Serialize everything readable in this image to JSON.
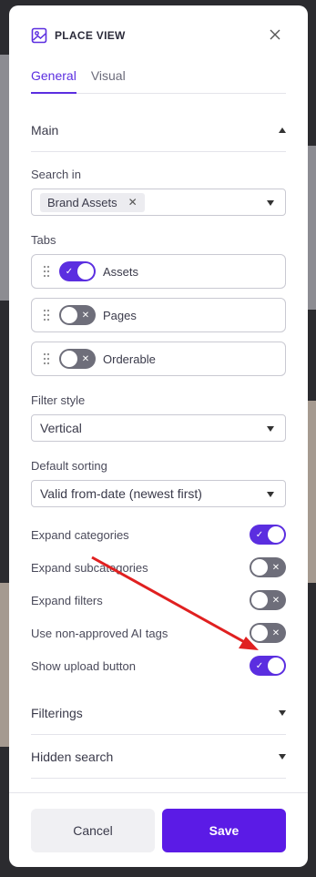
{
  "dialog": {
    "title": "PLACE VIEW",
    "icon": "image-icon",
    "close_icon": "close-icon",
    "accent_color": "#5b2ee0"
  },
  "tabs": [
    {
      "label": "General",
      "active": true
    },
    {
      "label": "Visual",
      "active": false
    }
  ],
  "main_section": {
    "label": "Main",
    "expanded": true,
    "search_in": {
      "label": "Search in",
      "chips": [
        "Brand Assets"
      ]
    },
    "tabs_field": {
      "label": "Tabs",
      "items": [
        {
          "label": "Assets",
          "enabled": true
        },
        {
          "label": "Pages",
          "enabled": false
        },
        {
          "label": "Orderable",
          "enabled": false
        }
      ]
    },
    "filter_style": {
      "label": "Filter style",
      "value": "Vertical"
    },
    "default_sorting": {
      "label": "Default sorting",
      "value": "Valid from-date (newest first)"
    },
    "options": [
      {
        "label": "Expand categories",
        "enabled": true
      },
      {
        "label": "Expand subcategories",
        "enabled": false
      },
      {
        "label": "Expand filters",
        "enabled": false
      },
      {
        "label": "Use non-approved AI tags",
        "enabled": false
      },
      {
        "label": "Show upload button",
        "enabled": true
      }
    ]
  },
  "collapsed_sections": [
    {
      "label": "Filterings"
    },
    {
      "label": "Hidden search"
    }
  ],
  "footer": {
    "cancel_label": "Cancel",
    "save_label": "Save"
  },
  "annotation": {
    "arrow_color": "#e02020"
  }
}
